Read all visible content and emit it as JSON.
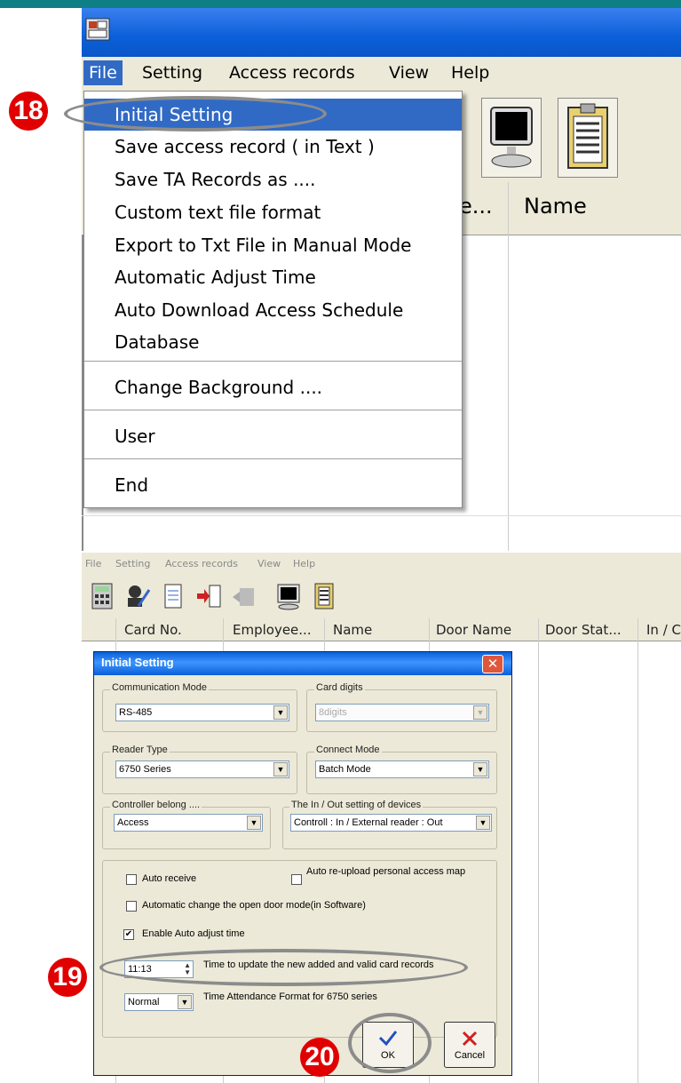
{
  "menubar": [
    "File",
    "Setting",
    "Access records",
    "View",
    "Help"
  ],
  "file_menu": {
    "groups": [
      [
        "Initial Setting",
        "Save access record ( in Text )",
        "Save TA Records as ....",
        "Custom text file format",
        "Export to Txt File in Manual Mode",
        "Automatic Adjust Time",
        "Auto Download Access Schedule",
        "Database"
      ],
      [
        "Change Background ...."
      ],
      [
        "User"
      ],
      [
        "End"
      ]
    ]
  },
  "grid1_headers": {
    "partial": "e...",
    "name": "Name"
  },
  "menubar2": [
    "File",
    "Setting",
    "Access records",
    "View",
    "Help"
  ],
  "grid2_headers": [
    "Card No.",
    "Employee...",
    "Name",
    "Door Name",
    "Door Stat...",
    "In / C"
  ],
  "dialog": {
    "title": "Initial Setting",
    "close": "✕",
    "communication_mode": {
      "label": "Communication Mode",
      "value": "RS-485"
    },
    "card_digits": {
      "label": "Card digits",
      "value": "8digits"
    },
    "reader_type": {
      "label": "Reader Type",
      "value": "6750 Series"
    },
    "connect_mode": {
      "label": "Connect Mode",
      "value": "Batch Mode"
    },
    "controller_belong": {
      "label": "Controller belong ....",
      "value": "Access"
    },
    "inout_setting": {
      "label": "The In / Out setting of devices",
      "value": "Controll : In / External reader : Out"
    },
    "auto_receive": "Auto receive",
    "auto_reupload": "Auto re-upload personal access map",
    "auto_change_door": "Automatic change the open door mode(in Software)",
    "enable_adjust": "Enable Auto adjust time",
    "time_value": "11:13",
    "time_label": "Time to update the new added and valid card records",
    "format_value": "Normal",
    "format_label": "Time Attendance Format for 6750 series",
    "ok": "OK",
    "cancel": "Cancel"
  },
  "badges": {
    "b18": "18",
    "b19": "19",
    "b20": "20"
  },
  "colors": {
    "accent": "#316ac5",
    "badge": "#e00000",
    "titlebar": "#0a5fd8"
  }
}
